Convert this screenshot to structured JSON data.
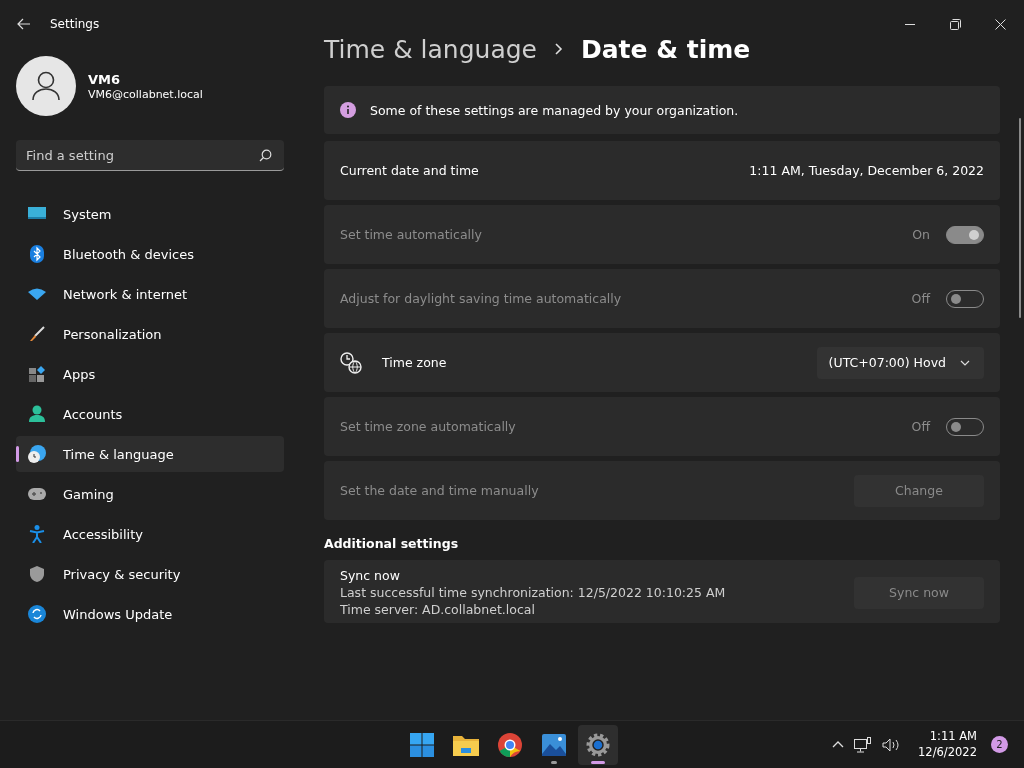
{
  "window": {
    "title": "Settings"
  },
  "profile": {
    "name": "VM6",
    "email": "VM6@collabnet.local"
  },
  "search": {
    "placeholder": "Find a setting"
  },
  "nav": [
    {
      "label": "System",
      "selected": false
    },
    {
      "label": "Bluetooth & devices",
      "selected": false
    },
    {
      "label": "Network & internet",
      "selected": false
    },
    {
      "label": "Personalization",
      "selected": false
    },
    {
      "label": "Apps",
      "selected": false
    },
    {
      "label": "Accounts",
      "selected": false
    },
    {
      "label": "Time & language",
      "selected": true
    },
    {
      "label": "Gaming",
      "selected": false
    },
    {
      "label": "Accessibility",
      "selected": false
    },
    {
      "label": "Privacy & security",
      "selected": false
    },
    {
      "label": "Windows Update",
      "selected": false
    }
  ],
  "breadcrumb": {
    "parent": "Time & language",
    "current": "Date & time"
  },
  "notice": "Some of these settings are managed by your organization.",
  "rows": [
    {
      "kind": "value",
      "label": "Current date and time",
      "value": "1:11 AM, Tuesday, December 6, 2022",
      "disabled": false
    },
    {
      "kind": "toggle",
      "label": "Set time automatically",
      "state_text": "On",
      "on": true,
      "disabled": true
    },
    {
      "kind": "toggle",
      "label": "Adjust for daylight saving time automatically",
      "state_text": "Off",
      "on": false,
      "disabled": true
    },
    {
      "kind": "dropdown",
      "label": "Time zone",
      "value": "(UTC+07:00) Hovd",
      "disabled": false
    },
    {
      "kind": "toggle",
      "label": "Set time zone automatically",
      "state_text": "Off",
      "on": false,
      "disabled": true
    },
    {
      "kind": "button",
      "label": "Set the date and time manually",
      "button": "Change",
      "disabled": true
    }
  ],
  "additional": {
    "heading": "Additional settings",
    "title": "Sync now",
    "lines": [
      "Last successful time synchronization: 12/5/2022 10:10:25 AM",
      "Time server: AD.collabnet.local"
    ],
    "button": "Sync now",
    "disabled": true
  },
  "taskbar": {
    "apps": [
      {
        "kind": "start",
        "running": false,
        "active": false
      },
      {
        "kind": "folder",
        "running": false,
        "active": false
      },
      {
        "kind": "browser",
        "running": false,
        "active": false
      },
      {
        "kind": "photos",
        "running": true,
        "active": false
      },
      {
        "kind": "settings",
        "running": true,
        "active": true
      }
    ],
    "time": "1:11 AM",
    "date": "12/6/2022",
    "notifications": "2"
  }
}
